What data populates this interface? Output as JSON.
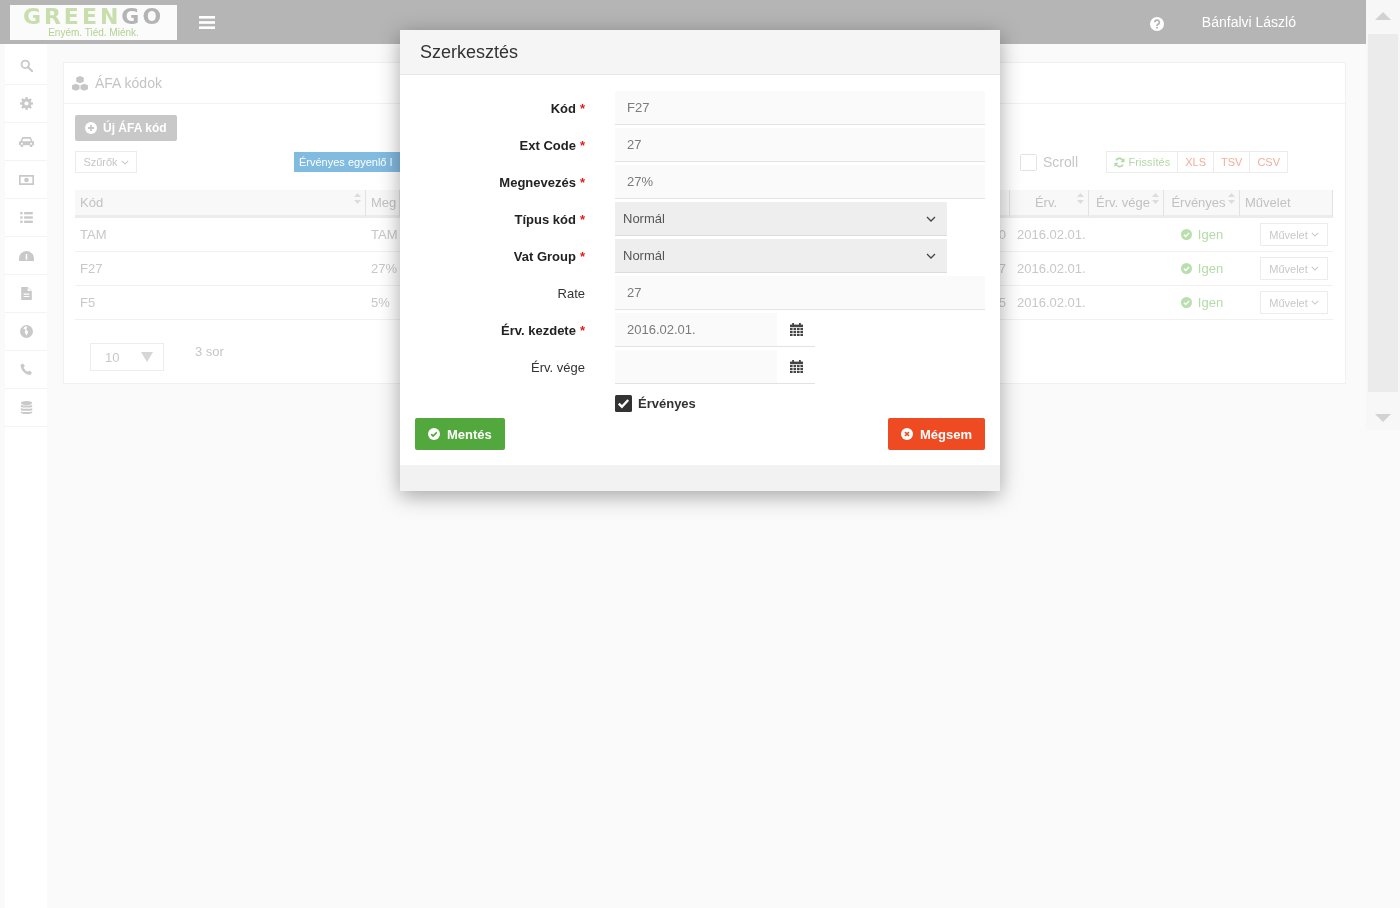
{
  "header": {
    "logo": {
      "word_1": "GREEN",
      "word_2": "GO",
      "tagline": "Enyém. Tiéd. Miénk."
    },
    "user_name": "Bánfalvi László"
  },
  "card": {
    "title": "ÁFA kódok",
    "new_button": "Új ÁFA kód",
    "filter_button": "Szűrők",
    "filter_tag": "Érvényes egyenlő I",
    "scroll_toggle": {
      "label": "Scroll",
      "checked": false
    },
    "toolbar_buttons": [
      {
        "label": "Frissítés",
        "kind": "refresh"
      },
      {
        "label": "XLS",
        "kind": "export"
      },
      {
        "label": "TSV",
        "kind": "export"
      },
      {
        "label": "CSV",
        "kind": "export"
      }
    ],
    "table": {
      "columns": [
        {
          "label": "Kód",
          "sortable": true
        },
        {
          "label": "Meg",
          "sortable": false
        },
        {
          "sortable": false
        },
        {
          "label": "Érv.",
          "sortable": true
        },
        {
          "label": "Érv. vége",
          "sortable": true
        },
        {
          "label": "Érvényes",
          "sortable": true
        },
        {
          "label": "Művelet",
          "sortable": false
        }
      ],
      "rows": [
        {
          "cells": [
            "TAM",
            "TAM",
            "0",
            "2016.02.01."
          ],
          "valid": true,
          "valid_label": "Igen",
          "action": "Művelet"
        },
        {
          "cells": [
            "F27",
            "27%",
            "7",
            "2016.02.01."
          ],
          "valid": true,
          "valid_label": "Igen",
          "action": "Művelet"
        },
        {
          "cells": [
            "F5",
            "5%",
            "5",
            "2016.02.01."
          ],
          "valid": true,
          "valid_label": "Igen",
          "action": "Művelet"
        }
      ]
    },
    "pager": {
      "page_size": "10",
      "row_count": "3 sor"
    }
  },
  "modal": {
    "title": "Szerkesztés",
    "fields": [
      {
        "kind": "text",
        "label": "Kód",
        "required_mark": "*",
        "value": "F27"
      },
      {
        "kind": "text",
        "label": "Ext Code",
        "required_mark": "*",
        "value": "27"
      },
      {
        "kind": "text",
        "label": "Megnevezés",
        "required_mark": "*",
        "value": "27%"
      },
      {
        "kind": "select",
        "label": "Típus kód",
        "required_mark": "*",
        "value": "Normál"
      },
      {
        "kind": "select",
        "label": "Vat Group",
        "required_mark": "*",
        "value": "Normál"
      },
      {
        "kind": "text",
        "label": "Rate",
        "value": "27"
      },
      {
        "kind": "date",
        "label": "Érv. kezdete",
        "required_mark": "*",
        "value": "2016.02.01."
      },
      {
        "kind": "date",
        "label": "Érv. vége"
      },
      {
        "kind": "checkbox",
        "label": "Érvényes",
        "checked": true
      }
    ],
    "buttons": [
      {
        "label": "Mentés",
        "kind": "save"
      },
      {
        "label": "Mégsem",
        "kind": "cancel"
      }
    ]
  }
}
